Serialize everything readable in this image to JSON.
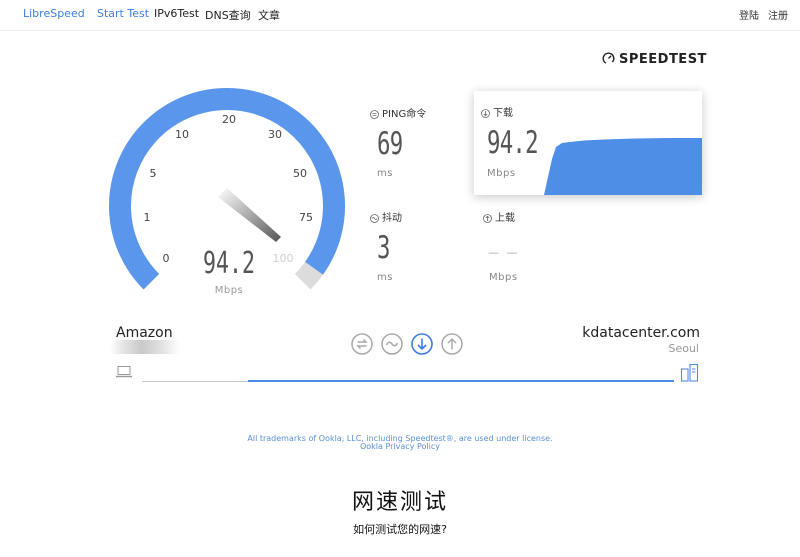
{
  "nav": {
    "brand": "LibreSpeed",
    "links": [
      "Start Test",
      "IPv6Test",
      "DNS查询",
      "文章"
    ],
    "active_link": "Start Test",
    "login": "登陆",
    "register": "注册"
  },
  "speedtest_logo": "SPEEDTEST",
  "gauge": {
    "value": "94.2",
    "unit": "Mbps",
    "ticks": [
      "0",
      "1",
      "5",
      "10",
      "20",
      "30",
      "50",
      "75",
      "100"
    ],
    "needle_value": 94.2,
    "arc_color": "#5a97ec"
  },
  "metrics": {
    "ping": {
      "label": "PING命令",
      "value": "69",
      "unit": "ms"
    },
    "jitter": {
      "label": "抖动",
      "value": "3",
      "unit": "ms"
    },
    "download": {
      "label": "下载",
      "value": "94.2",
      "unit": "Mbps"
    },
    "upload": {
      "label": "上载",
      "value": "— —",
      "unit": "Mbps"
    }
  },
  "servers": {
    "client": {
      "name": "Amazon"
    },
    "host": {
      "name": "kdatacenter.com",
      "location": "Seoul"
    }
  },
  "controls": [
    {
      "name": "ping-step-icon",
      "state": "done"
    },
    {
      "name": "jitter-step-icon",
      "state": "done"
    },
    {
      "name": "download-step-icon",
      "state": "active"
    },
    {
      "name": "upload-step-icon",
      "state": "pending"
    }
  ],
  "progress": {
    "fraction": 0.8
  },
  "legal": {
    "line1": "All trademarks of Ookla, LLC, including Speedtest®, are used under license.",
    "line2": "Ookla Privacy Policy"
  },
  "article": {
    "title": "网速测试",
    "subtitle": "如何测试您的网速?"
  },
  "colors": {
    "accent": "#3d7de3",
    "gauge_blue": "#5a97ec",
    "chart_blue": "#4f8ee6"
  }
}
